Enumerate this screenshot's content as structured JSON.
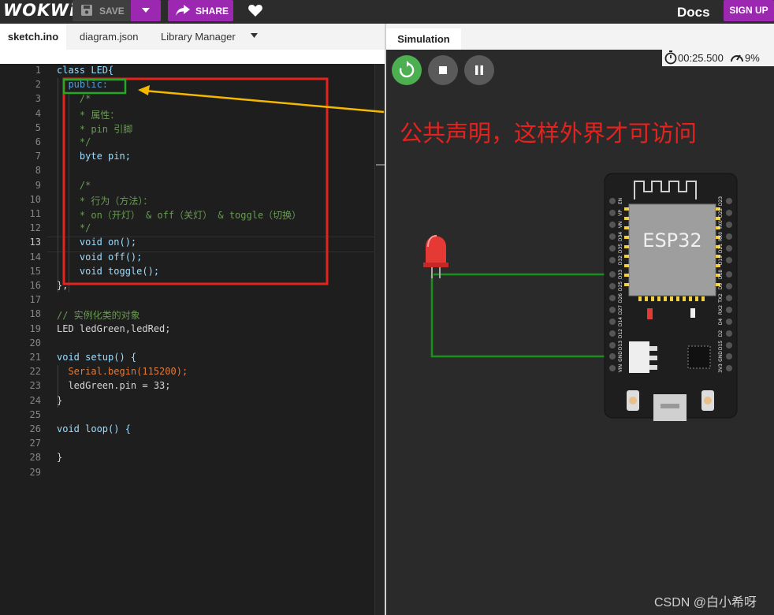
{
  "header": {
    "logo": "WOKWi",
    "save_label": "SAVE",
    "share_label": "SHARE",
    "docs_label": "Docs",
    "signup_label": "SIGN UP"
  },
  "editor_tabs": [
    "sketch.ino",
    "diagram.json",
    "Library Manager"
  ],
  "code": {
    "line_numbers": [
      "1",
      "2",
      "3",
      "4",
      "5",
      "6",
      "7",
      "8",
      "9",
      "10",
      "11",
      "12",
      "13",
      "14",
      "15",
      "16",
      "17",
      "18",
      "19",
      "20",
      "21",
      "22",
      "23",
      "24",
      "25",
      "26",
      "27",
      "28",
      "29"
    ],
    "lines": [
      "class LED{",
      "  public:",
      "    /*",
      "    * 属性：",
      "    * pin 引脚",
      "    */",
      "    byte pin;",
      "",
      "    /*",
      "    * 行为（方法）：",
      "    * on（开灯） & off（关灯） & toggle（切换）",
      "    */",
      "    void on();",
      "    void off();",
      "    void toggle();",
      "};",
      "",
      "// 实例化类的对象",
      "LED ledGreen,ledRed;",
      "",
      "void setup() {",
      "  Serial.begin(115200);",
      "  ledGreen.pin = 33;",
      "}",
      "",
      "void loop() {",
      "",
      "}",
      ""
    ]
  },
  "simulation": {
    "tab_label": "Simulation",
    "timer": "00:25.500",
    "speed": "9%",
    "board_label": "ESP32",
    "left_pins": [
      "EN",
      "VP",
      "VN",
      "D34",
      "D35",
      "D32",
      "D33",
      "D25",
      "D26",
      "D27",
      "D14",
      "D12",
      "D13",
      "GND",
      "VIN"
    ],
    "right_pins": [
      "D23",
      "D22",
      "TX0",
      "RX0",
      "D21",
      "D19",
      "D18",
      "D5",
      "TX2",
      "RX2",
      "D4",
      "D2",
      "D15",
      "GND",
      "3V3"
    ]
  },
  "annotation": {
    "text": "公共声明，这样外界才可访问"
  },
  "watermark": "CSDN @白小希呀",
  "colors": {
    "accent": "#9c27b0",
    "play": "#4caf50",
    "annotation_red": "#e5221e",
    "annotation_green": "#22aa22",
    "arrow": "#f5b800",
    "led": "#e53935",
    "wire": "#1b8f1b"
  }
}
